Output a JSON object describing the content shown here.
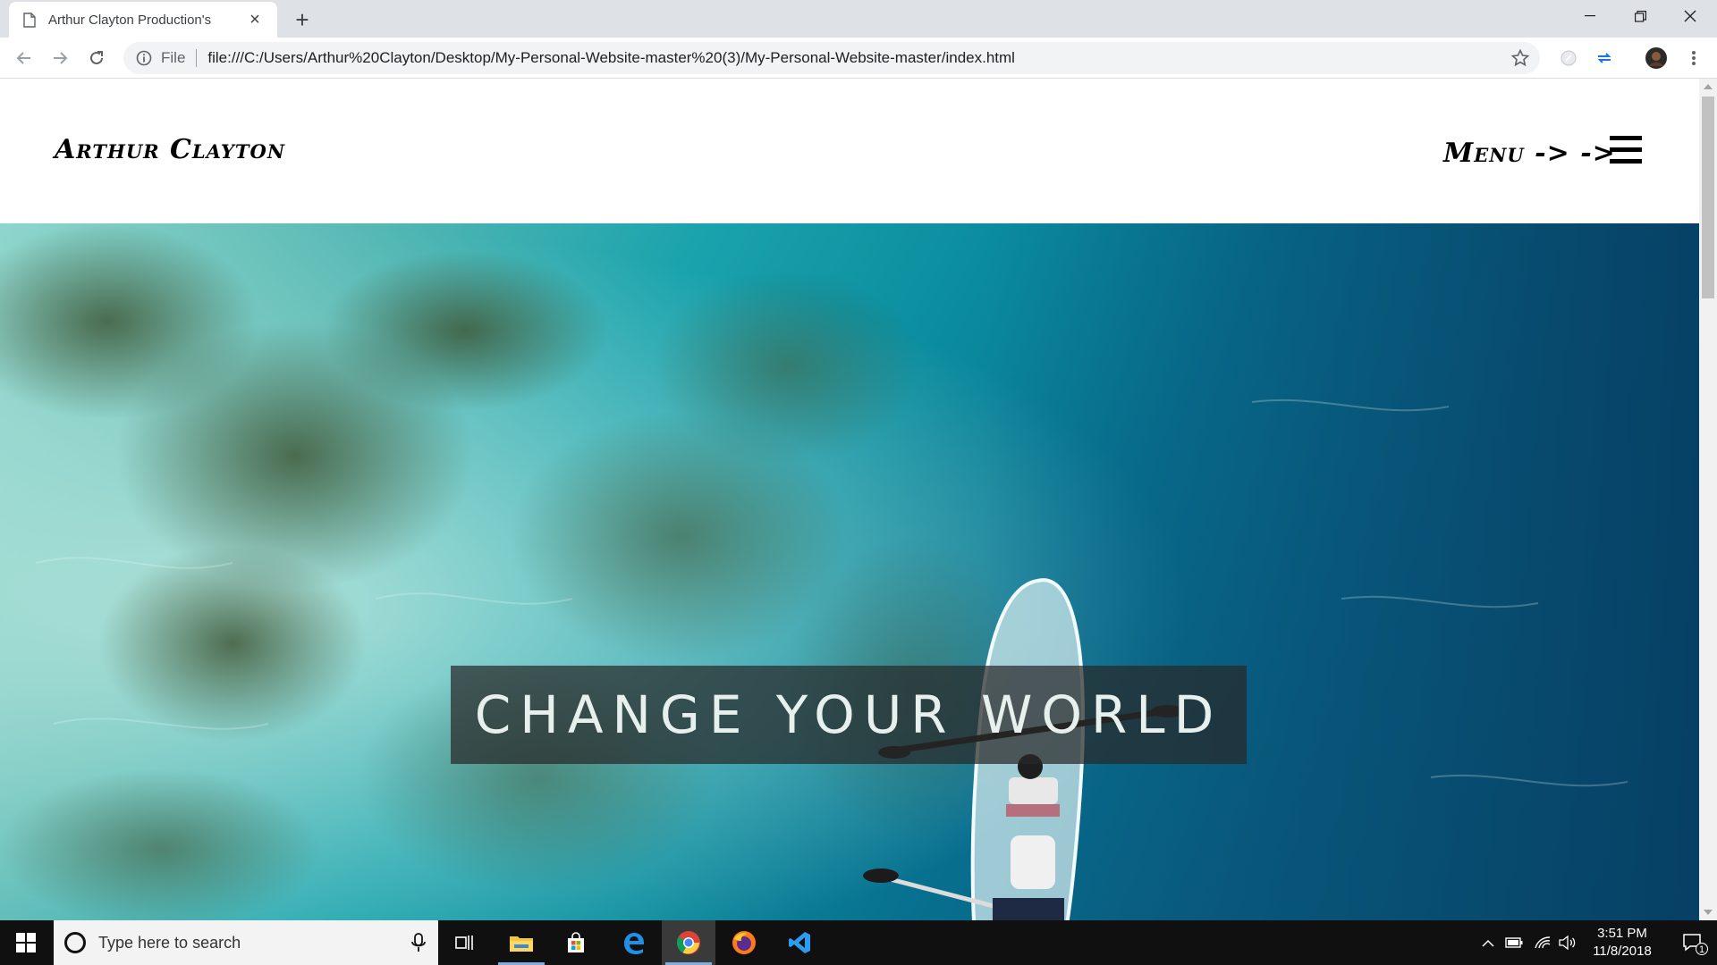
{
  "browser": {
    "tab_title": "Arthur Clayton Production's",
    "new_tab_symbol": "+",
    "close_tab_symbol": "×",
    "address_scheme": "File",
    "address_url": "file:///C:/Users/Arthur%20Clayton/Desktop/My-Personal-Website-master%20(3)/My-Personal-Website-master/index.html",
    "icons": [
      "doc-icon",
      "back-icon",
      "forward-icon",
      "reload-icon",
      "info-icon",
      "star-icon",
      "extension-icon",
      "sync-icon",
      "profile-avatar",
      "kebab-menu-icon",
      "minimize-icon",
      "restore-icon",
      "close-icon"
    ]
  },
  "site": {
    "title": "Arthur Clayton",
    "menu_label": "Menu -> ->",
    "hero_text": "CHANGE YOUR WORLD"
  },
  "taskbar": {
    "search_placeholder": "Type here to search",
    "time": "3:51 PM",
    "date": "11/8/2018",
    "notification_count": "1",
    "apps": [
      "task-view-icon",
      "file-explorer-icon",
      "store-icon",
      "edge-icon",
      "chrome-icon",
      "firefox-icon",
      "vscode-icon"
    ]
  },
  "colors": {
    "chrome_tabbar": "#dee1e6",
    "taskbar": "#101010",
    "hero_banner": "rgba(40,40,40,0.72)",
    "water_teal": "#1aa3ad",
    "water_deep": "#084a6e"
  }
}
